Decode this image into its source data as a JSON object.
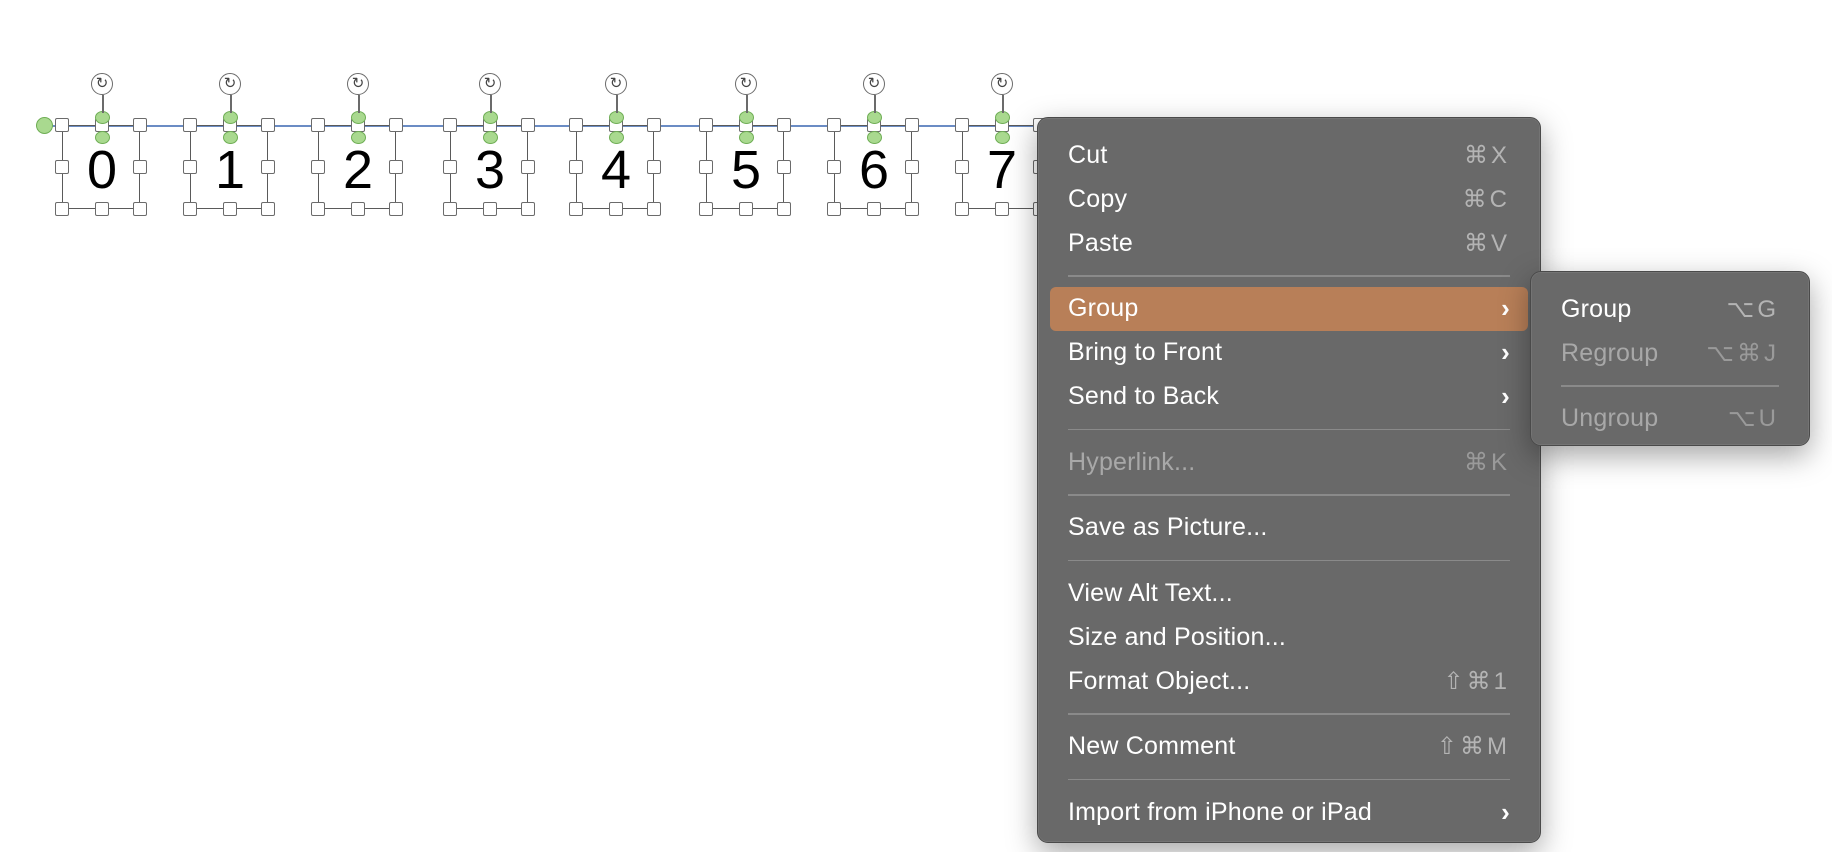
{
  "canvas": {
    "shapes": [
      {
        "label": "0"
      },
      {
        "label": "1"
      },
      {
        "label": "2"
      },
      {
        "label": "3"
      },
      {
        "label": "4"
      },
      {
        "label": "5"
      },
      {
        "label": "6"
      },
      {
        "label": "7"
      }
    ],
    "rotate_glyph": "↻"
  },
  "context_menu": {
    "items": [
      {
        "label": "Cut",
        "shortcut": "⌘X",
        "enabled": true
      },
      {
        "label": "Copy",
        "shortcut": "⌘C",
        "enabled": true
      },
      {
        "label": "Paste",
        "shortcut": "⌘V",
        "enabled": true
      },
      {
        "label": "Group",
        "submenu_chevron": "›",
        "highlighted": true
      },
      {
        "label": "Bring to Front",
        "submenu_chevron": "›"
      },
      {
        "label": "Send to Back",
        "submenu_chevron": "›"
      },
      {
        "label": "Hyperlink...",
        "shortcut": "⌘K",
        "enabled": false
      },
      {
        "label": "Save as Picture..."
      },
      {
        "label": "View Alt Text..."
      },
      {
        "label": "Size and Position..."
      },
      {
        "label": "Format Object...",
        "shortcut": "⇧⌘1"
      },
      {
        "label": "New Comment",
        "shortcut": "⇧⌘M"
      },
      {
        "label": "Import from iPhone or iPad",
        "submenu_chevron": "›"
      }
    ]
  },
  "group_submenu": {
    "items": [
      {
        "label": "Group",
        "shortcut": "⌥G",
        "enabled": true
      },
      {
        "label": "Regroup",
        "shortcut": "⌥⌘J",
        "enabled": false
      },
      {
        "label": "Ungroup",
        "shortcut": "⌥U",
        "enabled": false
      }
    ]
  },
  "colors": {
    "menu_background": "#696969",
    "highlight": "#b87f58",
    "adjust_handle": "#a9d98f",
    "guide_line": "#6b8cc4"
  }
}
